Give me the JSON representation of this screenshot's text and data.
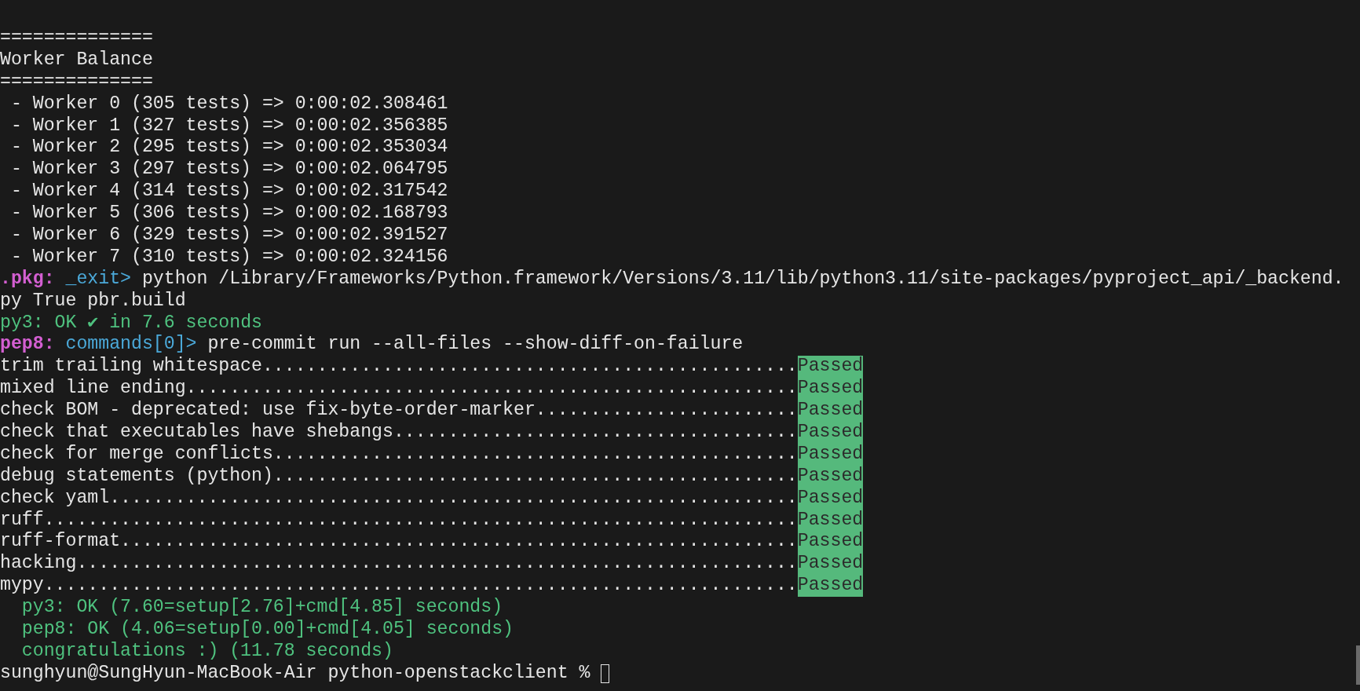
{
  "terminal": {
    "lines": [
      {
        "segments": [
          {
            "kind": "plain",
            "text": "=============="
          }
        ]
      },
      {
        "segments": [
          {
            "kind": "plain",
            "text": "Worker Balance"
          }
        ]
      },
      {
        "segments": [
          {
            "kind": "plain",
            "text": "=============="
          }
        ]
      },
      {
        "segments": [
          {
            "kind": "plain",
            "text": " - Worker 0 (305 tests) => 0:00:02.308461"
          }
        ]
      },
      {
        "segments": [
          {
            "kind": "plain",
            "text": " - Worker 1 (327 tests) => 0:00:02.356385"
          }
        ]
      },
      {
        "segments": [
          {
            "kind": "plain",
            "text": " - Worker 2 (295 tests) => 0:00:02.353034"
          }
        ]
      },
      {
        "segments": [
          {
            "kind": "plain",
            "text": " - Worker 3 (297 tests) => 0:00:02.064795"
          }
        ]
      },
      {
        "segments": [
          {
            "kind": "plain",
            "text": " - Worker 4 (314 tests) => 0:00:02.317542"
          }
        ]
      },
      {
        "segments": [
          {
            "kind": "plain",
            "text": " - Worker 5 (306 tests) => 0:00:02.168793"
          }
        ]
      },
      {
        "segments": [
          {
            "kind": "plain",
            "text": " - Worker 6 (329 tests) => 0:00:02.391527"
          }
        ]
      },
      {
        "segments": [
          {
            "kind": "plain",
            "text": " - Worker 7 (310 tests) => 0:00:02.324156"
          }
        ]
      },
      {
        "segments": [
          {
            "kind": "env",
            "text": ".pkg:"
          },
          {
            "kind": "command",
            "text": " _exit>"
          },
          {
            "kind": "plain",
            "text": " python /Library/Frameworks/Python.framework/Versions/3.11/lib/python3.11/site-packages/pyproject_api/_backend."
          }
        ]
      },
      {
        "segments": [
          {
            "kind": "plain",
            "text": "py True pbr.build"
          }
        ]
      },
      {
        "segments": [
          {
            "kind": "ok",
            "text": "py3: OK ✔ in 7.6 seconds"
          }
        ]
      },
      {
        "segments": [
          {
            "kind": "env",
            "text": "pep8:"
          },
          {
            "kind": "command",
            "text": " commands[0]>"
          },
          {
            "kind": "plain",
            "text": " pre-commit run --all-files --show-diff-on-failure"
          }
        ]
      },
      {
        "segments": [
          {
            "kind": "plain",
            "text": "trim trailing whitespace................................................."
          },
          {
            "kind": "badge",
            "text": "Passed"
          }
        ]
      },
      {
        "segments": [
          {
            "kind": "plain",
            "text": "mixed line ending........................................................"
          },
          {
            "kind": "badge",
            "text": "Passed"
          }
        ]
      },
      {
        "segments": [
          {
            "kind": "plain",
            "text": "check BOM - deprecated: use fix-byte-order-marker........................"
          },
          {
            "kind": "badge",
            "text": "Passed"
          }
        ]
      },
      {
        "segments": [
          {
            "kind": "plain",
            "text": "check that executables have shebangs....................................."
          },
          {
            "kind": "badge",
            "text": "Passed"
          }
        ]
      },
      {
        "segments": [
          {
            "kind": "plain",
            "text": "check for merge conflicts................................................"
          },
          {
            "kind": "badge",
            "text": "Passed"
          }
        ]
      },
      {
        "segments": [
          {
            "kind": "plain",
            "text": "debug statements (python)................................................"
          },
          {
            "kind": "badge",
            "text": "Passed"
          }
        ]
      },
      {
        "segments": [
          {
            "kind": "plain",
            "text": "check yaml..............................................................."
          },
          {
            "kind": "badge",
            "text": "Passed"
          }
        ]
      },
      {
        "segments": [
          {
            "kind": "plain",
            "text": "ruff....................................................................."
          },
          {
            "kind": "badge",
            "text": "Passed"
          }
        ]
      },
      {
        "segments": [
          {
            "kind": "plain",
            "text": "ruff-format.............................................................."
          },
          {
            "kind": "badge",
            "text": "Passed"
          }
        ]
      },
      {
        "segments": [
          {
            "kind": "plain",
            "text": "hacking.................................................................."
          },
          {
            "kind": "badge",
            "text": "Passed"
          }
        ]
      },
      {
        "segments": [
          {
            "kind": "plain",
            "text": "mypy....................................................................."
          },
          {
            "kind": "badge",
            "text": "Passed"
          }
        ]
      },
      {
        "segments": [
          {
            "kind": "ok",
            "text": "  py3: OK (7.60=setup[2.76]+cmd[4.85] seconds)"
          }
        ]
      },
      {
        "segments": [
          {
            "kind": "ok",
            "text": "  pep8: OK (4.06=setup[0.00]+cmd[4.05] seconds)"
          }
        ]
      },
      {
        "segments": [
          {
            "kind": "ok",
            "text": "  congratulations :) (11.78 seconds)"
          }
        ]
      },
      {
        "segments": [
          {
            "kind": "plain",
            "text": "sunghyun@SungHyun-MacBook-Air python-openstackclient % "
          },
          {
            "kind": "cursor"
          }
        ]
      }
    ]
  }
}
